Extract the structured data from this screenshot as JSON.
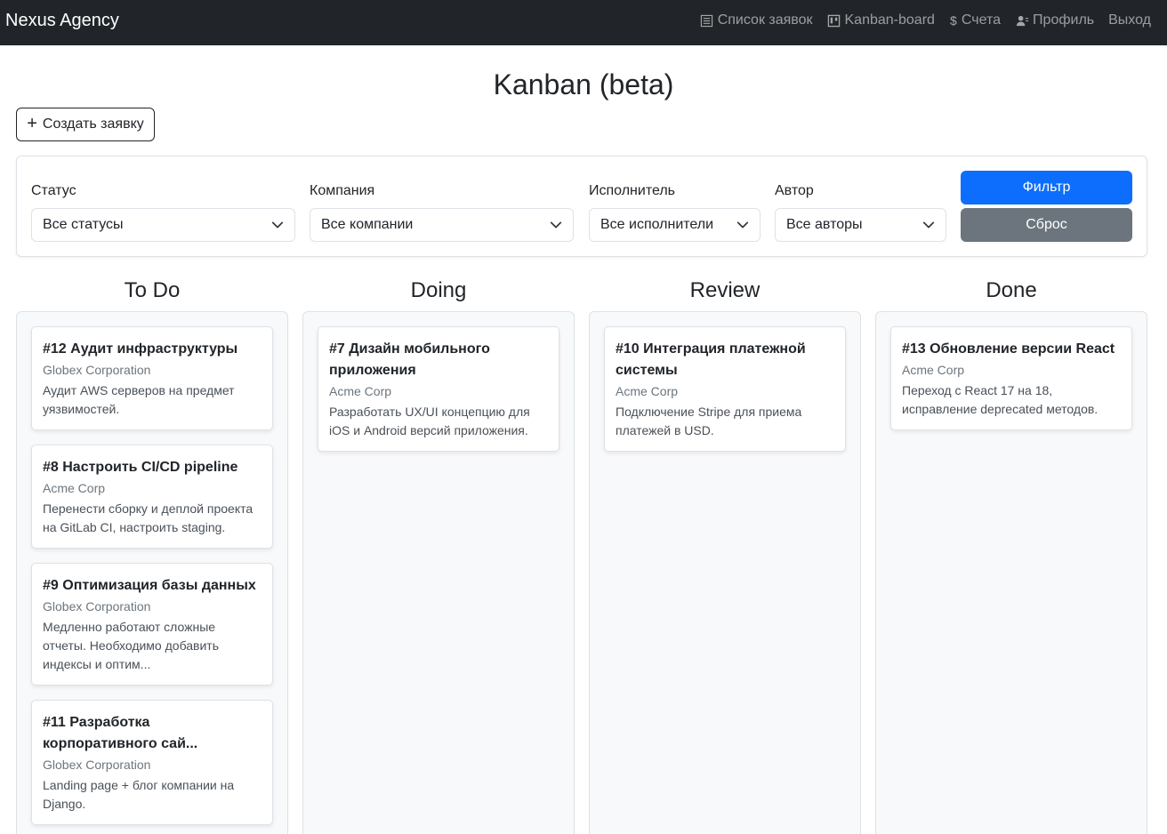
{
  "navbar": {
    "brand": "Nexus Agency",
    "links": [
      {
        "label": "Список заявок",
        "icon": "list-icon"
      },
      {
        "label": "Kanban-board",
        "icon": "kanban-icon"
      },
      {
        "label": "Счета",
        "icon": "dollar-icon"
      },
      {
        "label": "Профиль",
        "icon": "user-icon"
      },
      {
        "label": "Выход",
        "icon": ""
      }
    ]
  },
  "page": {
    "title": "Kanban (beta)",
    "create_label": "Создать заявку"
  },
  "filters": {
    "status": {
      "label": "Статус",
      "value": "Все статусы"
    },
    "company": {
      "label": "Компания",
      "value": "Все компании"
    },
    "assignee": {
      "label": "Исполнитель",
      "value": "Все исполнители"
    },
    "author": {
      "label": "Автор",
      "value": "Все авторы"
    },
    "filter_label": "Фильтр",
    "reset_label": "Сброс"
  },
  "colors": {
    "navbar": "#212529",
    "primary": "#0d6efd",
    "secondary": "#6c757d"
  },
  "columns": [
    {
      "title": "To Do",
      "cards": [
        {
          "title": "#12 Аудит инфраструктуры",
          "company": "Globex Corporation",
          "desc": "Аудит AWS серверов на предмет уязвимостей."
        },
        {
          "title": "#8 Настроить CI/CD pipeline",
          "company": "Acme Corp",
          "desc": "Перенести сборку и деплой проекта на GitLab CI, настроить staging."
        },
        {
          "title": "#9 Оптимизация базы данных",
          "company": "Globex Corporation",
          "desc": "Медленно работают сложные отчеты. Необходимо добавить индексы и оптим..."
        },
        {
          "title": "#11 Разработка корпоративного сай...",
          "company": "Globex Corporation",
          "desc": "Landing page + блог компании на Django."
        }
      ]
    },
    {
      "title": "Doing",
      "cards": [
        {
          "title": "#7 Дизайн мобильного приложения",
          "company": "Acme Corp",
          "desc": "Разработать UX/UI концепцию для iOS и Android версий приложения."
        }
      ]
    },
    {
      "title": "Review",
      "cards": [
        {
          "title": "#10 Интеграция платежной системы",
          "company": "Acme Corp",
          "desc": "Подключение Stripe для приема платежей в USD."
        }
      ]
    },
    {
      "title": "Done",
      "cards": [
        {
          "title": "#13 Обновление версии React",
          "company": "Acme Corp",
          "desc": "Переход с React 17 на 18, исправление deprecated методов."
        }
      ]
    }
  ]
}
